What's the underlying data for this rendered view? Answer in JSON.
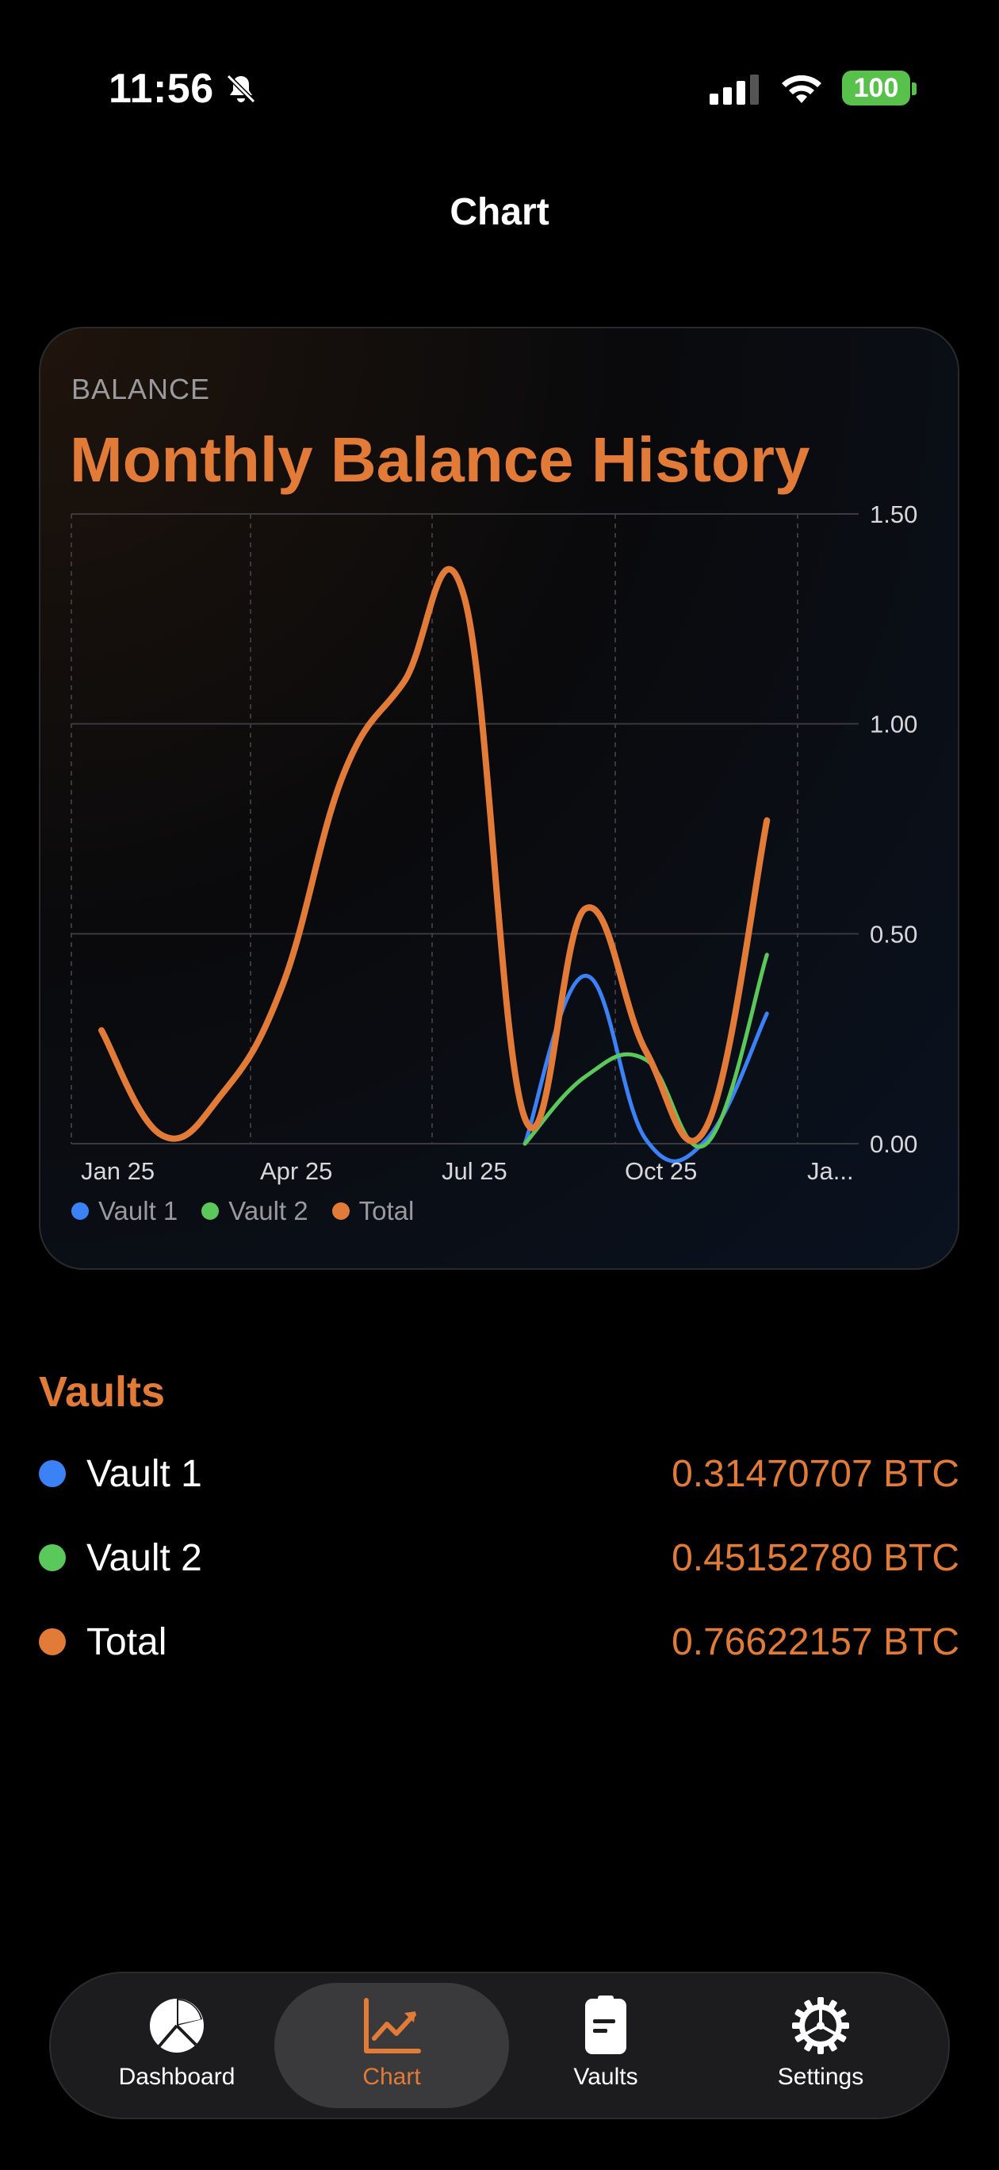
{
  "status_bar": {
    "time": "11:56",
    "battery": "100",
    "icons": [
      "bell-slash-icon",
      "cellular-signal-icon",
      "wifi-icon",
      "battery-icon"
    ]
  },
  "nav": {
    "title": "Chart"
  },
  "card": {
    "eyebrow": "BALANCE",
    "title": "Monthly Balance History"
  },
  "chart_data": {
    "type": "line",
    "x": [
      "2025-01",
      "2025-02",
      "2025-03",
      "2025-04",
      "2025-05",
      "2025-06",
      "2025-07",
      "2025-08",
      "2025-09",
      "2025-10",
      "2025-11",
      "2025-12"
    ],
    "x_tick_labels": [
      "Jan 25",
      "Apr 25",
      "Jul 25",
      "Oct 25",
      "Ja..."
    ],
    "ylim": [
      0,
      1.5
    ],
    "y_ticks": [
      "0.00",
      "0.50",
      "1.00",
      "1.50"
    ],
    "grid": true,
    "legend_position": "bottom-left",
    "series": [
      {
        "name": "Vault 1",
        "color": "#3b82f6",
        "values": [
          null,
          null,
          null,
          null,
          null,
          null,
          null,
          0.0,
          0.4,
          0.01,
          0.01,
          0.31
        ]
      },
      {
        "name": "Vault 2",
        "color": "#5ac85a",
        "values": [
          null,
          null,
          null,
          null,
          null,
          null,
          null,
          0.0,
          0.16,
          0.2,
          0.0,
          0.45
        ]
      },
      {
        "name": "Total",
        "color": "#e27a38",
        "values": [
          0.27,
          0.02,
          0.12,
          0.38,
          0.88,
          1.1,
          1.3,
          0.06,
          0.56,
          0.22,
          0.04,
          0.77
        ]
      }
    ]
  },
  "legend": [
    {
      "label": "Vault 1",
      "color": "#3b82f6"
    },
    {
      "label": "Vault 2",
      "color": "#5ac85a"
    },
    {
      "label": "Total",
      "color": "#e27a38"
    }
  ],
  "vaults": {
    "heading": "Vaults",
    "rows": [
      {
        "name": "Vault 1",
        "value": "0.31470707 BTC",
        "color": "#3b82f6"
      },
      {
        "name": "Vault 2",
        "value": "0.45152780 BTC",
        "color": "#5ac85a"
      },
      {
        "name": "Total",
        "value": "0.76622157 BTC",
        "color": "#e27a38"
      }
    ]
  },
  "tabbar": {
    "tabs": [
      {
        "label": "Dashboard",
        "icon": "pie-chart-icon",
        "active": false
      },
      {
        "label": "Chart",
        "icon": "line-chart-icon",
        "active": true
      },
      {
        "label": "Vaults",
        "icon": "document-icon",
        "active": false
      },
      {
        "label": "Settings",
        "icon": "gear-icon",
        "active": false
      }
    ]
  },
  "colors": {
    "accent": "#e27a38",
    "background": "#000000"
  }
}
